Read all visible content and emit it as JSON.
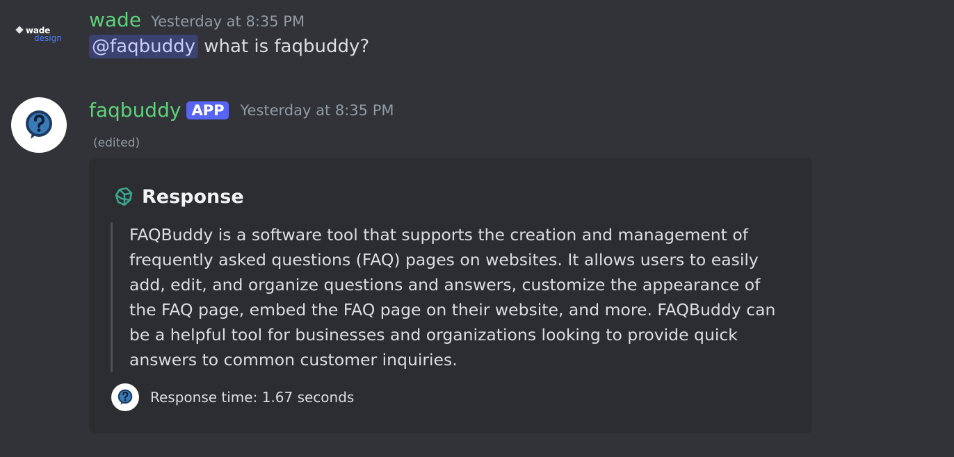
{
  "message1": {
    "avatar_logo_top": "wade",
    "avatar_logo_sub": "design",
    "username": "wade",
    "timestamp": "Yesterday at 8:35 PM",
    "mention": "@faqbuddy",
    "text": " what is faqbuddy?"
  },
  "message2": {
    "username": "faqbuddy",
    "badge": "APP",
    "timestamp": "Yesterday at 8:35 PM",
    "edited": "(edited)",
    "embed": {
      "title": "Response",
      "description": "FAQBuddy is a software tool that supports the creation and management of frequently asked questions (FAQ) pages on websites. It allows users to easily add, edit, and organize questions and answers, customize the appearance of the FAQ page, embed the FAQ page on their website, and more. FAQBuddy can be a helpful tool for businesses and organizations looking to provide quick answers to common customer inquiries.",
      "footer": "Response time: 1.67 seconds"
    }
  },
  "colors": {
    "background": "#313338",
    "embed_background": "#2b2d31",
    "username": "#5fd27a",
    "badge": "#5865f2",
    "mention_bg": "#3c4270"
  },
  "icons": {
    "bot_avatar": "question-bubble-icon",
    "embed_title_icon": "openai-knot-icon",
    "footer_icon": "question-bubble-icon"
  }
}
